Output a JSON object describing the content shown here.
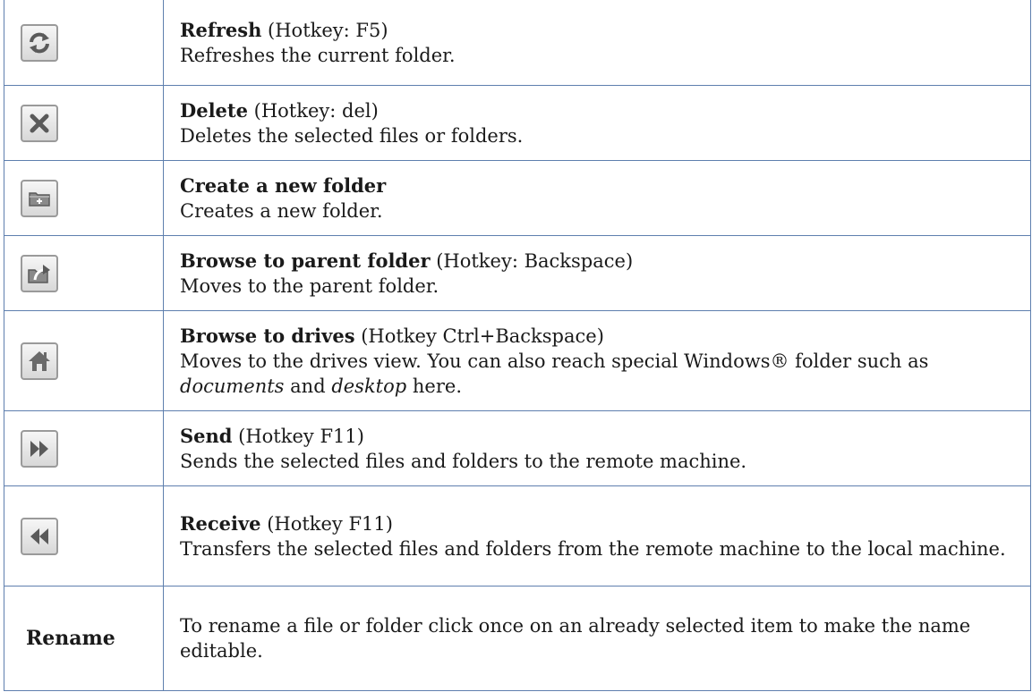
{
  "rows": [
    {
      "icon": "refresh-icon",
      "title": "Refresh",
      "hotkey": " (Hotkey: F5)",
      "description": "Refreshes the current folder."
    },
    {
      "icon": "delete-icon",
      "title": "Delete",
      "hotkey": " (Hotkey: del)",
      "description": "Deletes the selected files or folders."
    },
    {
      "icon": "new-folder-icon",
      "title": "Create a new folder",
      "hotkey": "",
      "description": "Creates a new folder."
    },
    {
      "icon": "parent-folder-icon",
      "title": "Browse to parent folder",
      "hotkey": " (Hotkey: Backspace)",
      "description": "Moves to the parent folder."
    },
    {
      "icon": "home-icon",
      "title": "Browse to drives",
      "hotkey": " (Hotkey Ctrl+Backspace)",
      "description_part1": "Moves to the drives view. You can also reach special Windows® folder such as ",
      "description_em1": "documents",
      "description_part2": " and ",
      "description_em2": "desktop",
      "description_part3": " here."
    },
    {
      "icon": "send-icon",
      "title": "Send",
      "hotkey": " (Hotkey F11)",
      "description": "Sends the selected files and folders to the remote machine."
    },
    {
      "icon": "receive-icon",
      "title": "Receive",
      "hotkey": " (Hotkey F11)",
      "description": "Transfers the selected files and folders from the remote machine to the local machine."
    },
    {
      "label": "Rename",
      "description": "To rename a file or folder click once on an already selected item to make the name editable."
    }
  ]
}
